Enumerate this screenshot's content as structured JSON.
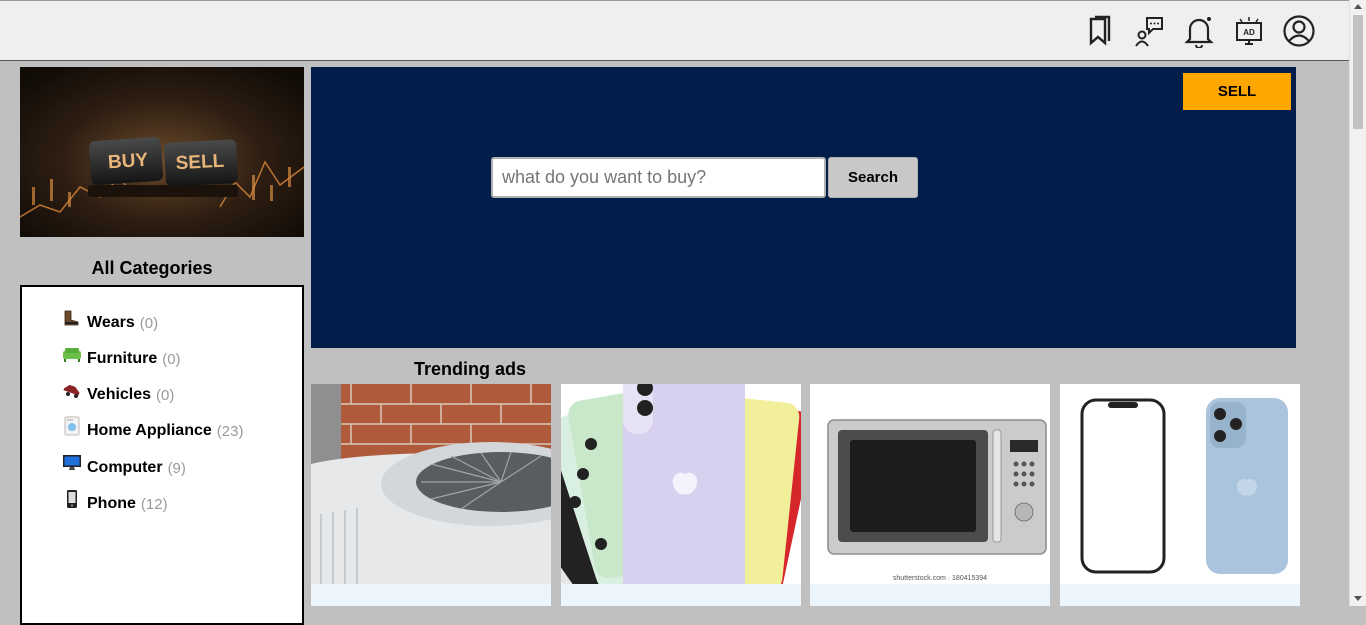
{
  "header": {
    "icons": [
      "bookmark-icon",
      "chat-support-icon",
      "bell-icon",
      "ad-display-icon",
      "user-profile-icon"
    ]
  },
  "banner": {
    "image_text_left": "BUY",
    "image_text_right": "SELL"
  },
  "categories": {
    "title": "All Categories",
    "items": [
      {
        "label": "Wears",
        "count": "(0)",
        "icon": "boot-icon"
      },
      {
        "label": "Furniture",
        "count": "(0)",
        "icon": "sofa-icon"
      },
      {
        "label": "Vehicles",
        "count": "(0)",
        "icon": "car-icon"
      },
      {
        "label": "Home Appliance",
        "count": "(23)",
        "icon": "appliance-icon"
      },
      {
        "label": "Computer",
        "count": "(9)",
        "icon": "computer-icon"
      },
      {
        "label": "Phone",
        "count": "(12)",
        "icon": "phone-icon"
      }
    ]
  },
  "hero": {
    "sell_label": "SELL",
    "search_placeholder": "what do you want to buy?",
    "search_value": "",
    "search_label": "Search"
  },
  "trending": {
    "title": "Trending ads",
    "cards": [
      {
        "image": "air-conditioner-image"
      },
      {
        "image": "iphone-11-image"
      },
      {
        "image": "microwave-image",
        "caption": "shutterstock.com · 180415394"
      },
      {
        "image": "iphone-13-image"
      }
    ]
  },
  "colors": {
    "hero_bg": "#001e49",
    "sell_bg": "#ffa600",
    "page_bg": "#c0c0c0",
    "card_bg": "#edf5fc"
  }
}
